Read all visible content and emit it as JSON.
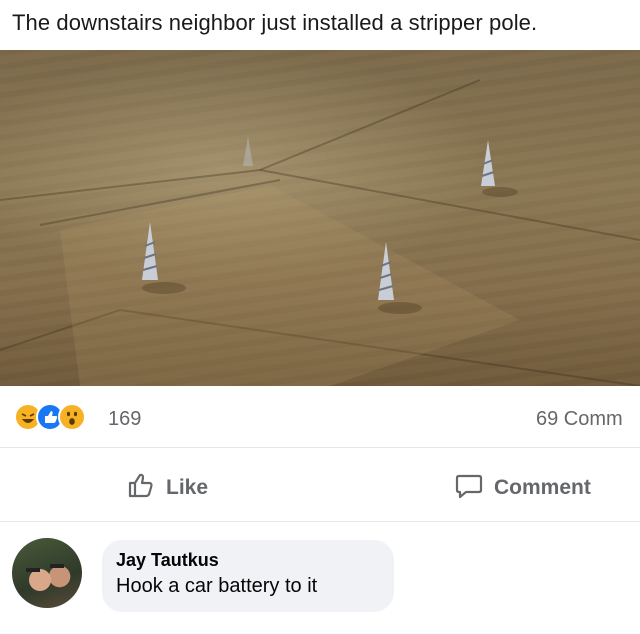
{
  "post": {
    "caption": "The downstairs neighbor just installed a stripper pole."
  },
  "reactions": {
    "icons": [
      "haha-icon",
      "like-icon",
      "wow-icon"
    ],
    "count": "169",
    "comments_count": "69 Comm"
  },
  "actions": {
    "like_label": "Like",
    "comment_label": "Comment"
  },
  "comment": {
    "author": "Jay Tautkus",
    "text": "Hook a car battery to it"
  },
  "colors": {
    "facebook_blue": "#1877f2",
    "reaction_yellow": "#f7b125",
    "secondary_text": "#65676b",
    "bubble_bg": "#f0f2f5"
  }
}
